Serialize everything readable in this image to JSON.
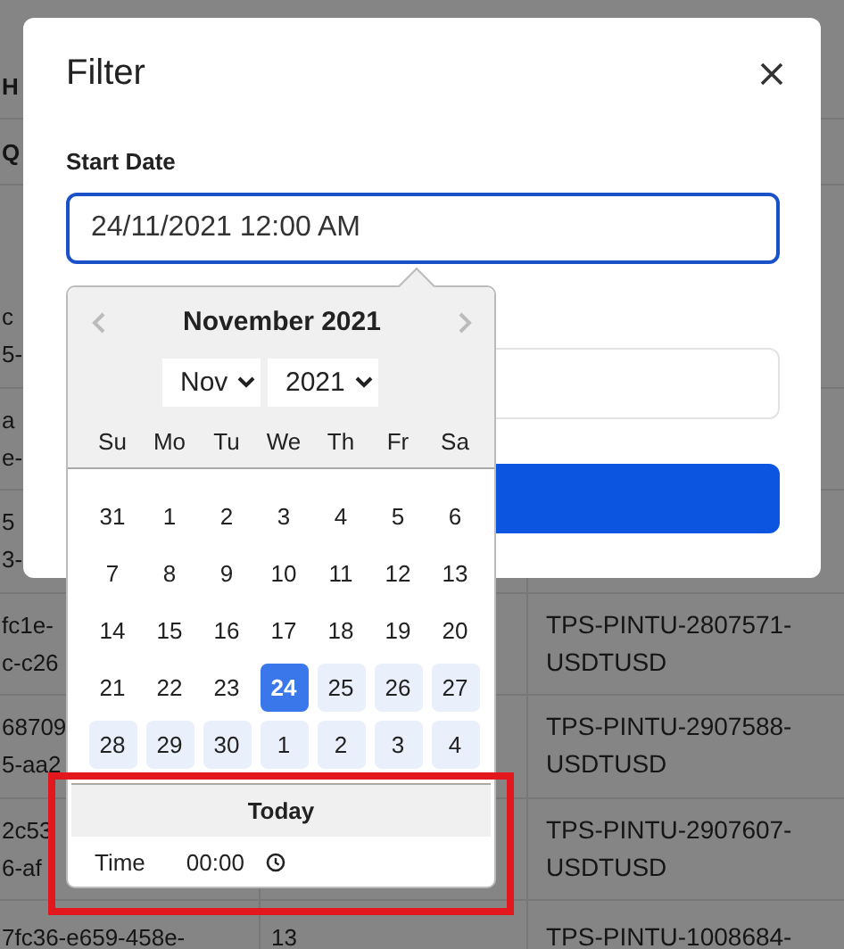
{
  "table": {
    "header_rows": [
      {
        "column_1": [
          "H"
        ]
      },
      {
        "column_1": [
          "Q"
        ]
      }
    ],
    "rows": [
      {
        "column_1": [
          "c",
          "5-"
        ]
      },
      {
        "column_1": [
          "a",
          "e-"
        ]
      },
      {
        "column_1": [
          "5",
          "3-"
        ]
      },
      {
        "column_1": [
          "fc1e-",
          "c-c26"
        ],
        "column_3": [
          "TPS-PINTU-2807571-",
          "USDTUSD"
        ]
      },
      {
        "column_1": [
          "68709",
          "5-aa2"
        ],
        "column_3": [
          "TPS-PINTU-2907588-",
          "USDTUSD"
        ]
      },
      {
        "column_1": [
          "2c53",
          "6-af"
        ],
        "column_3": [
          "TPS-PINTU-2907607-",
          "USDTUSD"
        ]
      },
      {
        "column_1": [
          "7fc36-e659-458e-"
        ],
        "column_2": [
          "13"
        ],
        "column_3": [
          "TPS-PINTU-1008684-"
        ]
      }
    ]
  },
  "modal": {
    "title": "Filter",
    "start_date": {
      "label": "Start Date",
      "value": "24/11/2021 12:00 AM",
      "focused": true
    }
  },
  "date_picker": {
    "title": "November 2021",
    "month": "Nov",
    "year": "2021",
    "weekdays": [
      "Su",
      "Mo",
      "Tu",
      "We",
      "Th",
      "Fr",
      "Sa"
    ],
    "weeks": [
      [
        {
          "day": "31",
          "selected": false,
          "in_range": false
        },
        {
          "day": "1",
          "selected": false,
          "in_range": false
        },
        {
          "day": "2",
          "selected": false,
          "in_range": false
        },
        {
          "day": "3",
          "selected": false,
          "in_range": false
        },
        {
          "day": "4",
          "selected": false,
          "in_range": false
        },
        {
          "day": "5",
          "selected": false,
          "in_range": false
        },
        {
          "day": "6",
          "selected": false,
          "in_range": false
        }
      ],
      [
        {
          "day": "7",
          "selected": false,
          "in_range": false
        },
        {
          "day": "8",
          "selected": false,
          "in_range": false
        },
        {
          "day": "9",
          "selected": false,
          "in_range": false
        },
        {
          "day": "10",
          "selected": false,
          "in_range": false
        },
        {
          "day": "11",
          "selected": false,
          "in_range": false
        },
        {
          "day": "12",
          "selected": false,
          "in_range": false
        },
        {
          "day": "13",
          "selected": false,
          "in_range": false
        }
      ],
      [
        {
          "day": "14",
          "selected": false,
          "in_range": false
        },
        {
          "day": "15",
          "selected": false,
          "in_range": false
        },
        {
          "day": "16",
          "selected": false,
          "in_range": false
        },
        {
          "day": "17",
          "selected": false,
          "in_range": false
        },
        {
          "day": "18",
          "selected": false,
          "in_range": false
        },
        {
          "day": "19",
          "selected": false,
          "in_range": false
        },
        {
          "day": "20",
          "selected": false,
          "in_range": false
        }
      ],
      [
        {
          "day": "21",
          "selected": false,
          "in_range": false
        },
        {
          "day": "22",
          "selected": false,
          "in_range": false
        },
        {
          "day": "23",
          "selected": false,
          "in_range": false
        },
        {
          "day": "24",
          "selected": true,
          "in_range": false
        },
        {
          "day": "25",
          "selected": false,
          "in_range": true
        },
        {
          "day": "26",
          "selected": false,
          "in_range": true
        },
        {
          "day": "27",
          "selected": false,
          "in_range": true
        }
      ],
      [
        {
          "day": "28",
          "selected": false,
          "in_range": true
        },
        {
          "day": "29",
          "selected": false,
          "in_range": true
        },
        {
          "day": "30",
          "selected": false,
          "in_range": true
        },
        {
          "day": "1",
          "selected": false,
          "in_range": true
        },
        {
          "day": "2",
          "selected": false,
          "in_range": true
        },
        {
          "day": "3",
          "selected": false,
          "in_range": true
        },
        {
          "day": "4",
          "selected": false,
          "in_range": true
        }
      ]
    ],
    "today_button": "Today",
    "time_label": "Time",
    "time_value": "00:00"
  }
}
